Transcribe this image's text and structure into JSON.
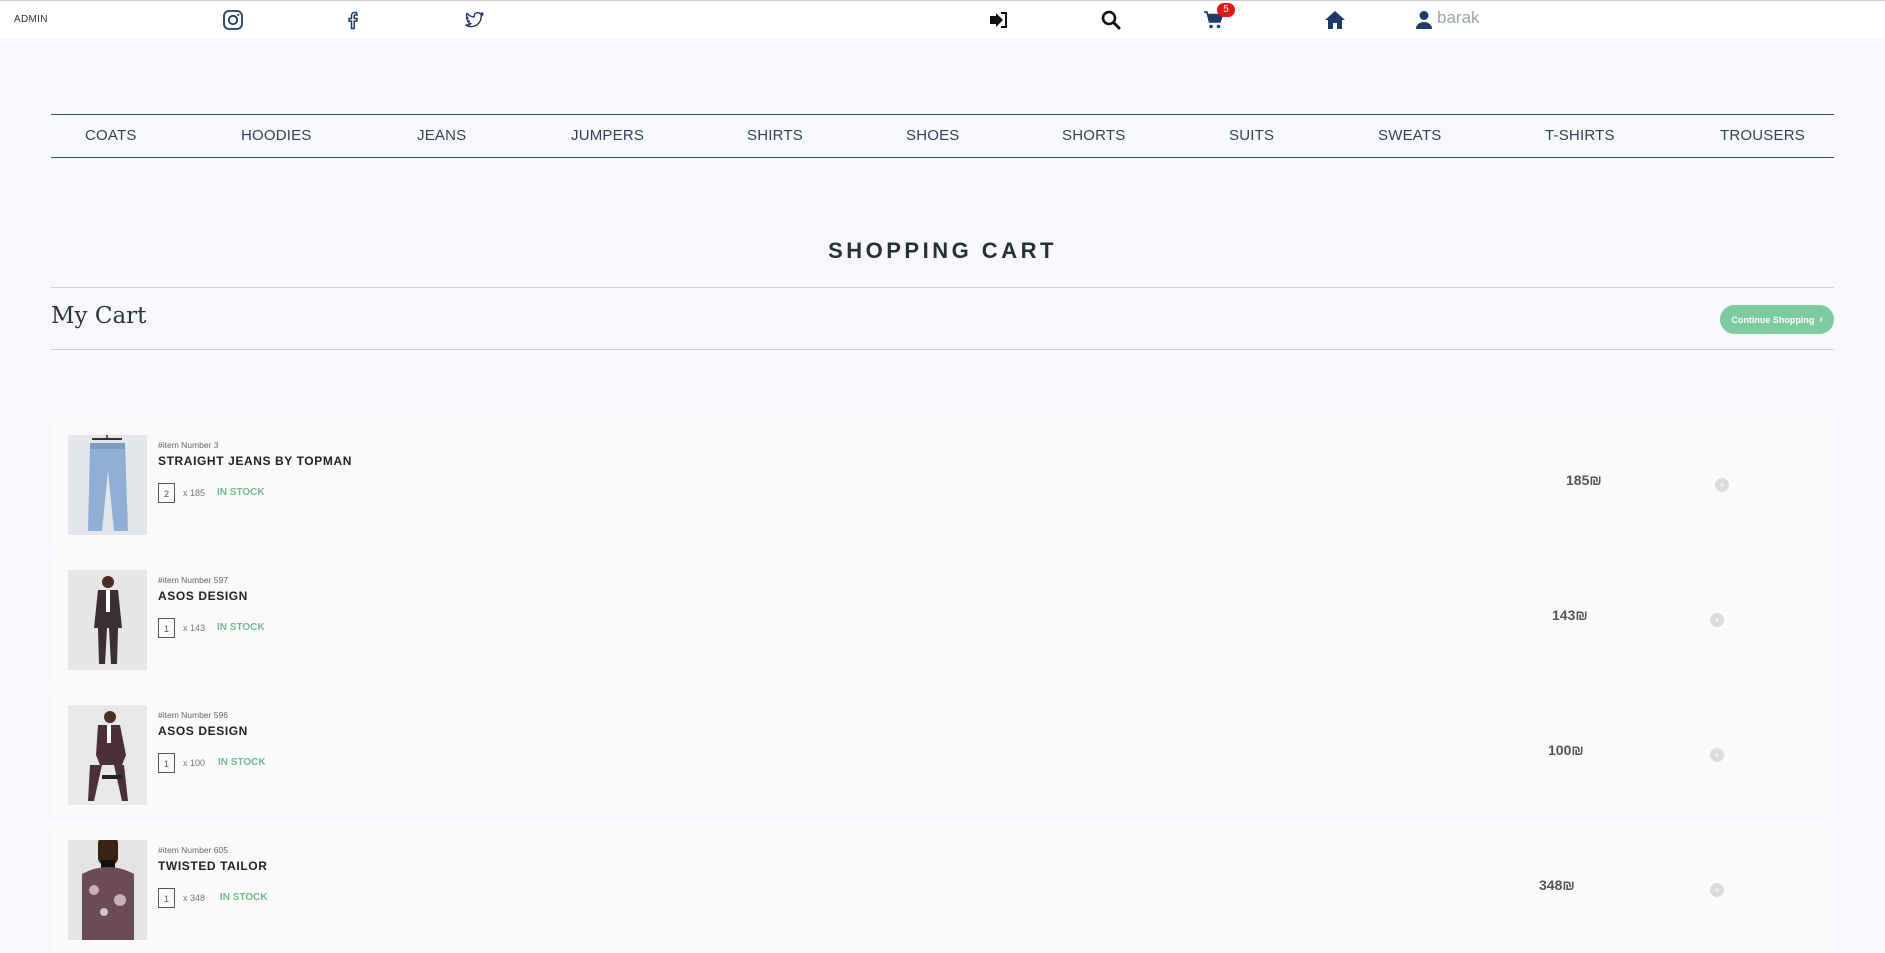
{
  "topbar": {
    "admin_label": "ADMIN",
    "cart_count": "5",
    "user_name": "barak"
  },
  "categories": [
    "COATS",
    "HOODIES",
    "JEANS",
    "JUMPERS",
    "SHIRTS",
    "SHOES",
    "SHORTS",
    "SUITS",
    "SWEATS",
    "T-SHIRTS",
    "TROUSERS"
  ],
  "page": {
    "title": "SHOPPING CART",
    "subtitle": "My Cart",
    "continue_label": "Continue Shopping"
  },
  "cart_items": [
    {
      "item_number": "#item Number 3",
      "name": "STRAIGHT JEANS BY TOPMAN",
      "qty": "2",
      "unit": "x 185",
      "stock": "IN STOCK",
      "price": "185₪",
      "image": "jeans"
    },
    {
      "item_number": "#item Number 597",
      "name": "ASOS DESIGN",
      "qty": "1",
      "unit": "x 143",
      "stock": "IN STOCK",
      "price": "143₪",
      "image": "suit-man"
    },
    {
      "item_number": "#item Number 596",
      "name": "ASOS DESIGN",
      "qty": "1",
      "unit": "x 100",
      "stock": "IN STOCK",
      "price": "100₪",
      "image": "suit-man-seated"
    },
    {
      "item_number": "#item Number 605",
      "name": "TWISTED TAILOR",
      "qty": "1",
      "unit": "x 348",
      "stock": "IN STOCK",
      "price": "348₪",
      "image": "floral-jacket"
    }
  ],
  "colors": {
    "accent_green": "#7ecba0",
    "stock_green": "#6dbf93",
    "badge_red": "#e01818",
    "nav_dark": "#344056",
    "icon_navy": "#1f3a66"
  }
}
